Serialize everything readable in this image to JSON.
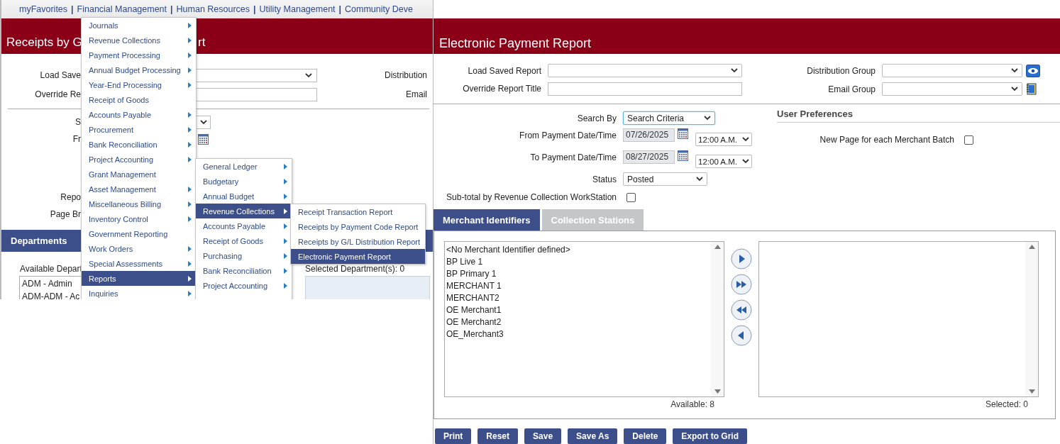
{
  "left_screen": {
    "nav": [
      {
        "kind": "link",
        "label": "myFavorites"
      },
      {
        "kind": "separator",
        "label": "|"
      },
      {
        "kind": "link",
        "label": "Financial Management"
      },
      {
        "kind": "separator",
        "label": "|"
      },
      {
        "kind": "link",
        "label": "Human Resources"
      },
      {
        "kind": "separator",
        "label": "|"
      },
      {
        "kind": "link",
        "label": "Utility Management"
      },
      {
        "kind": "separator",
        "label": "|"
      },
      {
        "kind": "link",
        "label": "Community Deve"
      }
    ],
    "title_parts": [
      "Receipts by G",
      "rt"
    ],
    "fields": [
      {
        "label": "Load Save",
        "kind": "select",
        "side_label": "Distribution"
      },
      {
        "label": "Override Re",
        "kind": "input",
        "side_label": "Email"
      }
    ],
    "criteria_top": [
      {
        "label": "S",
        "kind": "select"
      },
      {
        "label": "Fr",
        "kind": "calendar"
      }
    ],
    "criteria_bottom": [
      {
        "label": "Repo"
      },
      {
        "label": "Page Br"
      }
    ],
    "departments": {
      "title": "Departments",
      "available_label": "Available Depart",
      "available_items": [
        "ADM - Admin",
        "ADM-ADM - Ac"
      ],
      "selected_label": "Selected Department(s): 0"
    },
    "menu": [
      {
        "label": "Journals",
        "has_submenu": true,
        "selected": false
      },
      {
        "label": "Revenue Collections",
        "has_submenu": true,
        "selected": false
      },
      {
        "label": "Payment Processing",
        "has_submenu": true,
        "selected": false
      },
      {
        "label": "Annual Budget Processing",
        "has_submenu": true,
        "selected": false
      },
      {
        "label": "Year-End Processing",
        "has_submenu": true,
        "selected": false
      },
      {
        "label": "Receipt of Goods",
        "has_submenu": false,
        "selected": false
      },
      {
        "label": "Accounts Payable",
        "has_submenu": true,
        "selected": false
      },
      {
        "label": "Procurement",
        "has_submenu": true,
        "selected": false
      },
      {
        "label": "Bank Reconciliation",
        "has_submenu": true,
        "selected": false
      },
      {
        "label": "Project Accounting",
        "has_submenu": true,
        "selected": false
      },
      {
        "label": "Grant Management",
        "has_submenu": false,
        "selected": false
      },
      {
        "label": "Asset Management",
        "has_submenu": true,
        "selected": false
      },
      {
        "label": "Miscellaneous Billing",
        "has_submenu": true,
        "selected": false
      },
      {
        "label": "Inventory Control",
        "has_submenu": true,
        "selected": false
      },
      {
        "label": "Government Reporting",
        "has_submenu": false,
        "selected": false
      },
      {
        "label": "Work Orders",
        "has_submenu": true,
        "selected": false
      },
      {
        "label": "Special Assessments",
        "has_submenu": true,
        "selected": false
      },
      {
        "label": "Reports",
        "has_submenu": true,
        "selected": true
      },
      {
        "label": "Inquiries",
        "has_submenu": true,
        "selected": false
      }
    ],
    "submenu": [
      {
        "label": "General Ledger",
        "has_submenu": true,
        "selected": false
      },
      {
        "label": "Budgetary",
        "has_submenu": true,
        "selected": false
      },
      {
        "label": "Annual Budget",
        "has_submenu": true,
        "selected": false
      },
      {
        "label": "Revenue Collections",
        "has_submenu": true,
        "selected": true
      },
      {
        "label": "Accounts Payable",
        "has_submenu": true,
        "selected": false
      },
      {
        "label": "Receipt of Goods",
        "has_submenu": true,
        "selected": false
      },
      {
        "label": "Purchasing",
        "has_submenu": true,
        "selected": false
      },
      {
        "label": "Bank Reconciliation",
        "has_submenu": true,
        "selected": false
      },
      {
        "label": "Project Accounting",
        "has_submenu": true,
        "selected": false
      }
    ],
    "report_menu": [
      {
        "label": "Receipt Transaction Report",
        "selected": false
      },
      {
        "label": "Receipts by Payment Code Report",
        "selected": false
      },
      {
        "label": "Receipts by G/L Distribution Report",
        "selected": false
      },
      {
        "label": "Electronic Payment Report",
        "selected": true
      }
    ]
  },
  "report": {
    "title": "Electronic Payment Report",
    "top_left": [
      {
        "label": "Load Saved Report",
        "kind": "select"
      },
      {
        "label": "Override Report Title",
        "kind": "input"
      }
    ],
    "top_right": [
      {
        "label": "Distribution Group",
        "kind": "select"
      },
      {
        "label": "Email Group",
        "kind": "select"
      }
    ],
    "criteria": [
      {
        "label": "Search By",
        "kind": "select",
        "value": "Search Criteria",
        "focused": true
      },
      {
        "label": "From Payment Date/Time",
        "kind": "datetime",
        "date": "07/26/2025",
        "time": "12:00 A.M."
      },
      {
        "label": "To Payment Date/Time",
        "kind": "datetime",
        "date": "08/27/2025",
        "time": "12:00 A.M."
      },
      {
        "label": "Status",
        "kind": "select",
        "value": "Posted",
        "focused": false
      },
      {
        "label": "Sub-total by Revenue Collection WorkStation",
        "kind": "checkbox",
        "checked": false
      }
    ],
    "preferences": {
      "title": "User Preferences",
      "options": [
        {
          "label": "New Page for each Merchant Batch",
          "checked": false
        }
      ]
    },
    "tabs": [
      {
        "label": "Merchant Identifiers",
        "selected": true
      },
      {
        "label": "Collection Stations",
        "selected": false
      }
    ],
    "available": {
      "items": [
        "<No Merchant Identifier defined>",
        "BP Live 1",
        "BP Primary 1",
        "MERCHANT 1",
        "MERCHANT2",
        "OE Merchant1",
        "OE Merchant2",
        "OE_Merchant3"
      ],
      "count_label": "Available: 8"
    },
    "selected_list": {
      "count_label": "Selected: 0"
    },
    "buttons": [
      "Print",
      "Reset",
      "Save",
      "Save As",
      "Delete",
      "Export to Grid"
    ]
  }
}
